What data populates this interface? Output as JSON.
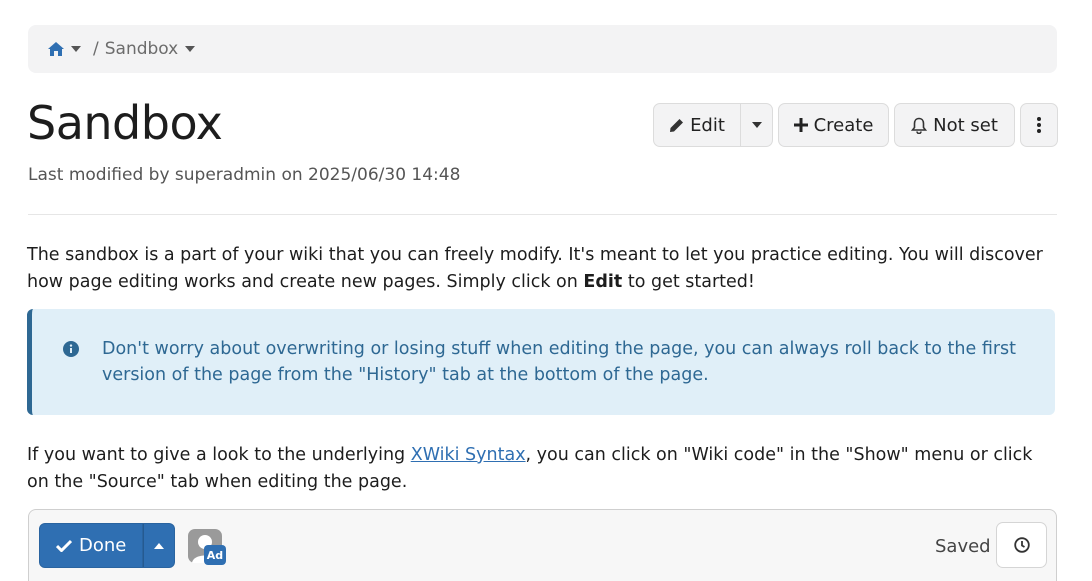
{
  "breadcrumb": {
    "home_icon": "home-icon",
    "separator": "/",
    "current": "Sandbox"
  },
  "page": {
    "title": "Sandbox",
    "modified": "Last modified by superadmin on 2025/06/30 14:48"
  },
  "actions": {
    "edit_label": "Edit",
    "create_label": "Create",
    "notifications_label": "Not set"
  },
  "content": {
    "intro_before": "The sandbox is a part of your wiki that you can freely modify. It's meant to let you practice editing. You will discover how page editing works and create new pages. Simply click on ",
    "intro_bold": "Edit",
    "intro_after": " to get started!",
    "info_box": "Don't worry about overwriting or losing stuff when editing the page, you can always roll back to the first version of the page from the \"History\" tab at the bottom of the page.",
    "syntax_before": "If you want to give a look to the underlying ",
    "syntax_link": "XWiki Syntax",
    "syntax_after": ", you can click on \"Wiki code\" in the \"Show\" menu or click on the \"Source\" tab when editing the page."
  },
  "editbar": {
    "done_label": "Done",
    "avatar_badge": "Ad",
    "saved_label": "Saved"
  },
  "colors": {
    "primary": "#2f6fb2",
    "info_bg": "#e0eff8",
    "info_text": "#2e6893"
  }
}
